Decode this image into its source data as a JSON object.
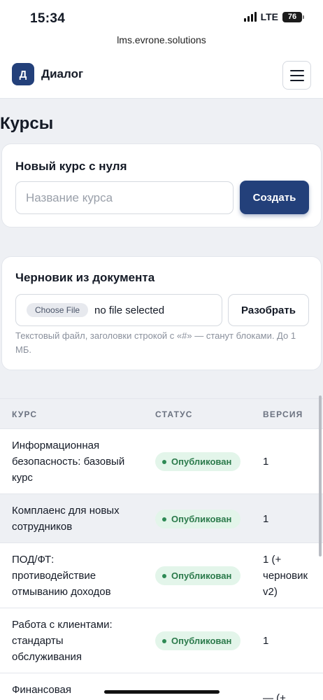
{
  "status_bar": {
    "time": "15:34",
    "network": "LTE",
    "battery": "76"
  },
  "browser": {
    "url": "lms.evrone.solutions"
  },
  "header": {
    "logo_letter": "Д",
    "app_name": "Диалог"
  },
  "page": {
    "title": "Курсы"
  },
  "new_course": {
    "title": "Новый курс с нуля",
    "input_placeholder": "Название курса",
    "input_value": "",
    "create_label": "Создать"
  },
  "draft": {
    "title": "Черновик из документа",
    "choose_file_label": "Choose File",
    "file_status": "no file selected",
    "parse_label": "Разобрать",
    "hint": "Текстовый файл, заголовки строкой с «#» — станут блоками. До 1 МБ."
  },
  "table": {
    "columns": [
      "КУРС",
      "СТАТУС",
      "ВЕРСИЯ"
    ],
    "rows": [
      {
        "title": "Информационная безопасность: базовый курс",
        "status": "Опубликован",
        "version": "1"
      },
      {
        "title": "Комплаенс для новых сотрудников",
        "status": "Опубликован",
        "version": "1"
      },
      {
        "title": "ПОД/ФТ: противодействие отмыванию доходов",
        "status": "Опубликован",
        "version": "1 (+ черновик v2)"
      },
      {
        "title": "Работа с клиентами: стандарты обслуживания",
        "status": "Опубликован",
        "version": "1"
      },
      {
        "title": "Финансовая",
        "status": "",
        "version": "— (+"
      }
    ]
  },
  "colors": {
    "primary": "#23407a",
    "status_published_bg": "#e3f5ea",
    "status_published_text": "#2b7a4b"
  }
}
